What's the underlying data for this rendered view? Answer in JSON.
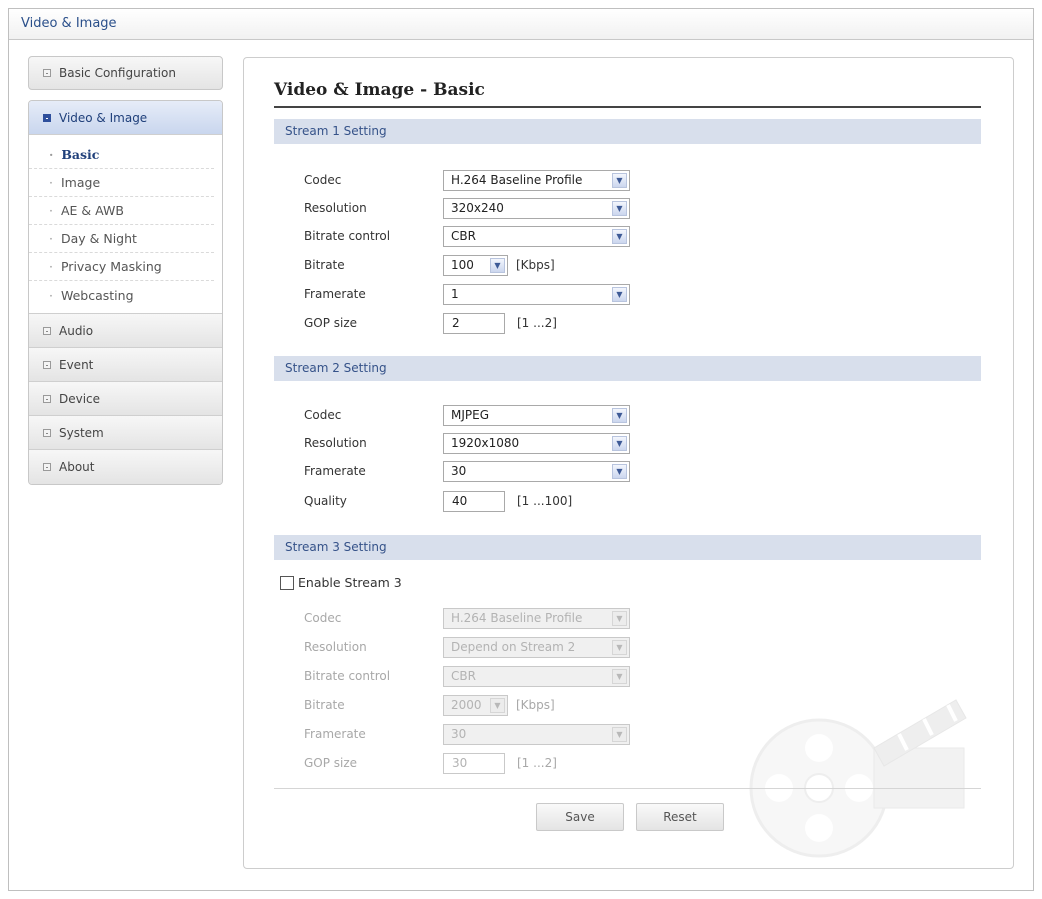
{
  "window": {
    "title": "Video & Image"
  },
  "sidebar": {
    "basic_configuration": "Basic Configuration",
    "video_image": "Video & Image",
    "sub_items": [
      {
        "label": "Basic",
        "current": true
      },
      {
        "label": "Image",
        "current": false
      },
      {
        "label": "AE & AWB",
        "current": false
      },
      {
        "label": "Day & Night",
        "current": false
      },
      {
        "label": "Privacy Masking",
        "current": false
      },
      {
        "label": "Webcasting",
        "current": false
      }
    ],
    "items": [
      "Audio",
      "Event",
      "Device",
      "System",
      "About"
    ]
  },
  "main": {
    "page_title": "Video & Image - Basic",
    "stream1": {
      "heading": "Stream 1 Setting",
      "codec_label": "Codec",
      "codec_value": "H.264 Baseline Profile",
      "resolution_label": "Resolution",
      "resolution_value": "320x240",
      "bitrate_control_label": "Bitrate control",
      "bitrate_control_value": "CBR",
      "bitrate_label": "Bitrate",
      "bitrate_value": "100",
      "bitrate_unit": "[Kbps]",
      "framerate_label": "Framerate",
      "framerate_value": "1",
      "gop_label": "GOP size",
      "gop_value": "2",
      "gop_range": "[1 ...2]"
    },
    "stream2": {
      "heading": "Stream 2 Setting",
      "codec_label": "Codec",
      "codec_value": "MJPEG",
      "resolution_label": "Resolution",
      "resolution_value": "1920x1080",
      "framerate_label": "Framerate",
      "framerate_value": "30",
      "quality_label": "Quality",
      "quality_value": "40",
      "quality_range": "[1 ...100]"
    },
    "stream3": {
      "heading": "Stream 3 Setting",
      "enable_label": "Enable Stream 3",
      "enabled": false,
      "codec_label": "Codec",
      "codec_value": "H.264 Baseline Profile",
      "resolution_label": "Resolution",
      "resolution_value": "Depend on Stream 2",
      "bitrate_control_label": "Bitrate control",
      "bitrate_control_value": "CBR",
      "bitrate_label": "Bitrate",
      "bitrate_value": "2000",
      "bitrate_unit": "[Kbps]",
      "framerate_label": "Framerate",
      "framerate_value": "30",
      "gop_label": "GOP size",
      "gop_value": "30",
      "gop_range": "[1 ...2]"
    },
    "buttons": {
      "save": "Save",
      "reset": "Reset"
    }
  },
  "icons": {
    "sidebar_bullet": "square-bullet-icon",
    "dropdown": "chevron-down-icon",
    "decoration": "film-reel-clapper-icon"
  },
  "colors": {
    "section_header_bg": "#d8dfec",
    "accent_text": "#355289",
    "active_nav": "#c9d6ee"
  }
}
